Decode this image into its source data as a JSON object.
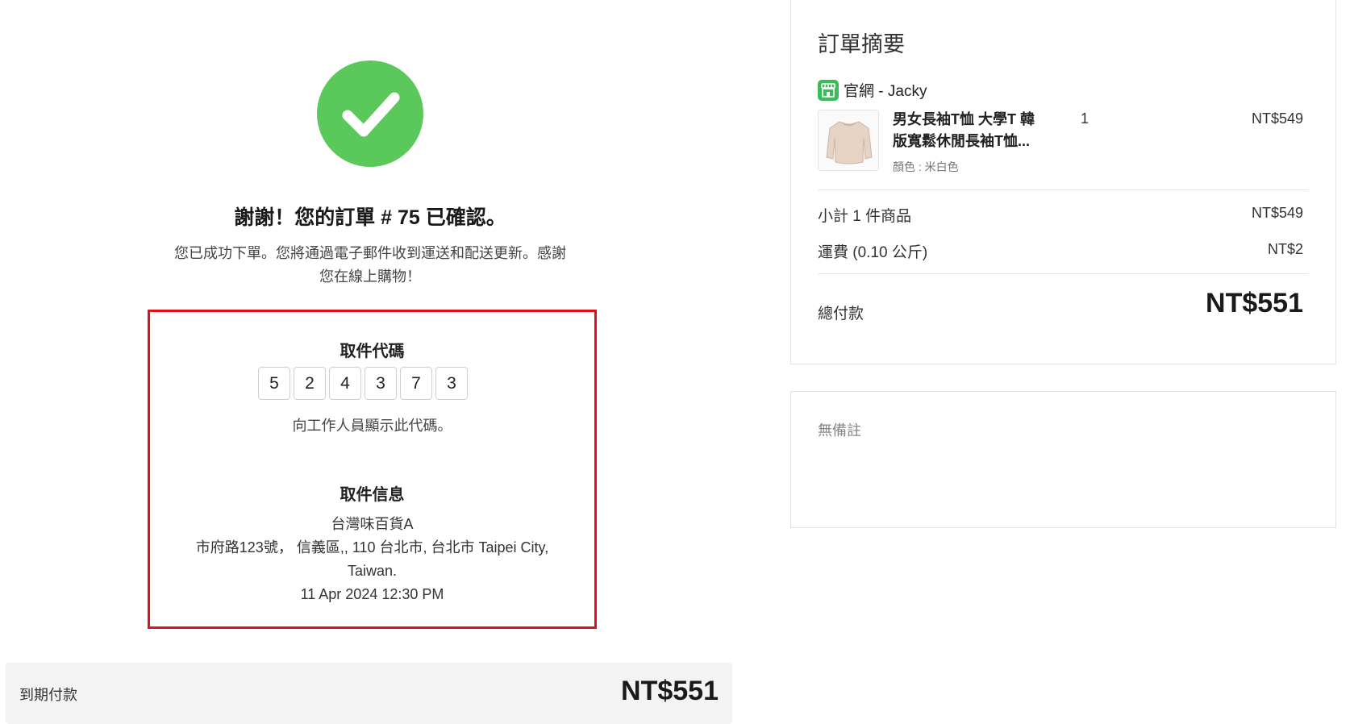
{
  "confirmation": {
    "title": "謝謝！您的訂單 # 75 已確認。",
    "message_line1": "您已成功下單。您將通過電子郵件收到運送和配送更新。感謝",
    "message_line2": "您在線上購物！"
  },
  "pickup": {
    "code_title": "取件代碼",
    "code_digits": [
      "5",
      "2",
      "4",
      "3",
      "7",
      "3"
    ],
    "code_hint": "向工作人員顯示此代碼。",
    "info_title": "取件信息",
    "store_name": "台灣味百貨A",
    "address_line1": "市府路123號， 信義區,, 110 台北市, 台北市 Taipei City,",
    "address_line2": "Taiwan.",
    "datetime": "11 Apr 2024 12:30 PM"
  },
  "due": {
    "label": "到期付款",
    "amount": "NT$551"
  },
  "summary": {
    "title": "訂單摘要",
    "store_label": "官網 - Jacky",
    "product": {
      "name_line1": "男女長袖T恤 大學T 韓",
      "name_line2": "版寬鬆休閒長袖T恤...",
      "variant": "顏色 : 米白色",
      "quantity": "1",
      "price": "NT$549"
    },
    "subtotal_label": "小計 1 件商品",
    "subtotal_value": "NT$549",
    "shipping_label": "運費 (0.10 公斤)",
    "shipping_value": "NT$2",
    "total_label": "總付款",
    "total_value": "NT$551"
  },
  "notes": {
    "text": "無備註"
  },
  "colors": {
    "success_green": "#5ac85a",
    "highlight_red": "#e0101a",
    "store_icon_green": "#3dbb5a"
  }
}
